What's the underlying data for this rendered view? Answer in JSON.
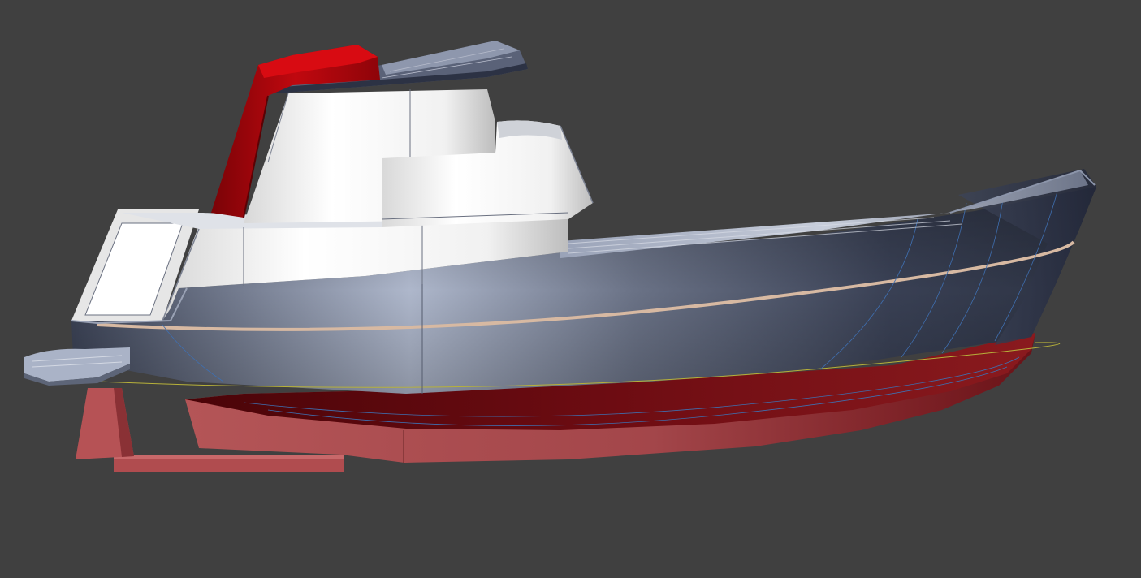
{
  "scene": {
    "background_color": "#404040",
    "subject": "tugboat-hull-3d-render",
    "colors": {
      "hull_navy": "#3a4155",
      "hull_highlight": "#aab3c8",
      "antifouling_red": "#b24f52",
      "antifouling_dark": "#6e0f12",
      "superstructure_white": "#f4f4f4",
      "stack_red": "#b8050c",
      "rub_rail_tan": "#d7b9a2",
      "waterline_yellow": "#b7b13a",
      "panel_lines_blue": "#3f6fb0"
    }
  }
}
